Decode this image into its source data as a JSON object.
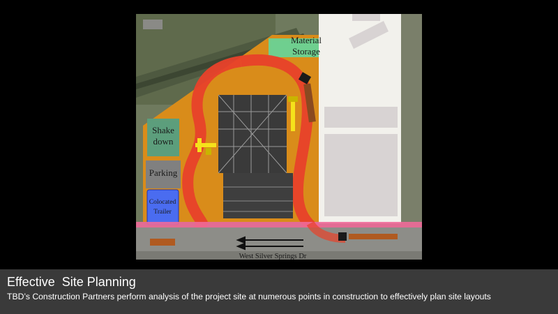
{
  "site_plan": {
    "labels": {
      "material_storage_line1": "Material",
      "material_storage_line2": "Storage",
      "shakedown_line1": "Shake",
      "shakedown_line2": "down",
      "parking": "Parking",
      "trailer_line1": "Colocated",
      "trailer_line2": "Trailer",
      "street": "West Silver Springs Dr"
    },
    "colors": {
      "site_area": "#d98c1a",
      "haul_route": "#e8412a",
      "material_storage": "#6fcf8f",
      "shakedown": "#5c9e7c",
      "parking": "#808080",
      "trailer": "#4a6cf0",
      "property_line": "#f06a9a",
      "equipment": "#f5e21b"
    }
  },
  "caption": {
    "title": "Effective  Site Planning",
    "subtitle": "TBD’s Construction Partners perform analysis of the project site at numerous points in construction to effectively plan site layouts"
  }
}
